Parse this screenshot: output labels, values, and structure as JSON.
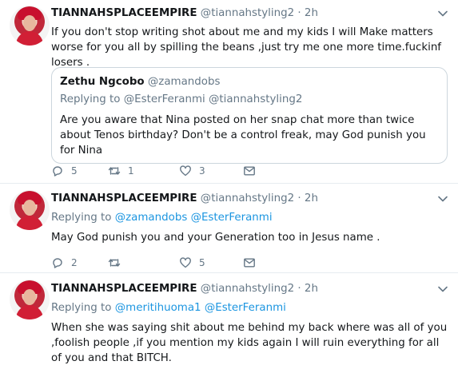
{
  "tweets": [
    {
      "author": {
        "name": "TIANNAHSPLACEEMPIRE",
        "handle": "@tiannahstyling2",
        "time": "· 2h"
      },
      "text": "If you don't stop writing shot about me and my kids I will Make matters worse for you all by spilling the beans ,just try me one more time.fuckinf losers .",
      "quote": {
        "name": "Zethu Ngcobo",
        "handle": "@zamandobs",
        "replying_prefix": "Replying to",
        "replying_to": "@EsterFeranmi @tiannahstyling2",
        "text": "Are you aware that Nina posted on her snap chat more than twice about Tenos birthday? Don't be a control freak, may God punish you for Nina"
      },
      "actions": {
        "replies": "5",
        "retweets": "1",
        "likes": "3"
      }
    },
    {
      "author": {
        "name": "TIANNAHSPLACEEMPIRE",
        "handle": "@tiannahstyling2",
        "time": "· 2h"
      },
      "replying_prefix": "Replying to",
      "replying_to": [
        "@zamandobs",
        "@EsterFeranmi"
      ],
      "text": "May God punish you and your Generation too in Jesus name .",
      "actions": {
        "replies": "2",
        "retweets": "",
        "likes": "5"
      }
    },
    {
      "author": {
        "name": "TIANNAHSPLACEEMPIRE",
        "handle": "@tiannahstyling2",
        "time": "· 2h"
      },
      "replying_prefix": "Replying to",
      "replying_to": [
        "@meritihuoma1",
        "@EsterFeranmi"
      ],
      "text": "When she was saying shit about me behind my back where was all of you ,foolish people ,if you mention my kids again I will ruin everything for all of you and that BITCH."
    }
  ],
  "icons": {
    "reply": "reply-icon",
    "retweet": "retweet-icon",
    "like": "heart-icon",
    "message": "envelope-icon",
    "more": "chevron-down-icon"
  },
  "colors": {
    "link": "#1b95e0",
    "secondary": "#657786",
    "text": "#14171a",
    "border": "#e6ecf0"
  }
}
